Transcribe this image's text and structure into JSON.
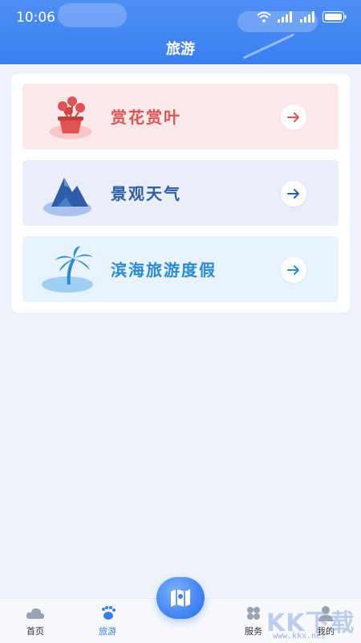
{
  "status_bar": {
    "time": "10:06"
  },
  "header": {
    "title": "旅游"
  },
  "cards": [
    {
      "label": "赏花赏叶",
      "icon": "flower-pot-icon",
      "bg": "#fde9e9",
      "color": "#e05353"
    },
    {
      "label": "景观天气",
      "icon": "mountain-icon",
      "bg": "#e9eef8",
      "color": "#2f5ea8"
    },
    {
      "label": "滨海旅游度假",
      "icon": "palm-tree-icon",
      "bg": "#e8f3fd",
      "color": "#2b8ad6"
    }
  ],
  "bottom_nav": {
    "items": [
      {
        "label": "首页",
        "icon": "cloud-icon"
      },
      {
        "label": "旅游",
        "icon": "footprints-icon",
        "active": true
      },
      {
        "label": "服务",
        "icon": "grid-icon"
      },
      {
        "label": "我的",
        "icon": "user-icon"
      }
    ],
    "center_icon": "map-icon"
  },
  "watermark": {
    "logo": "KK下载",
    "url": "www.kkx.net"
  },
  "colors": {
    "primary": "#3a7ff0",
    "active_nav": "#3a7ff0",
    "inactive_nav": "#333333"
  }
}
